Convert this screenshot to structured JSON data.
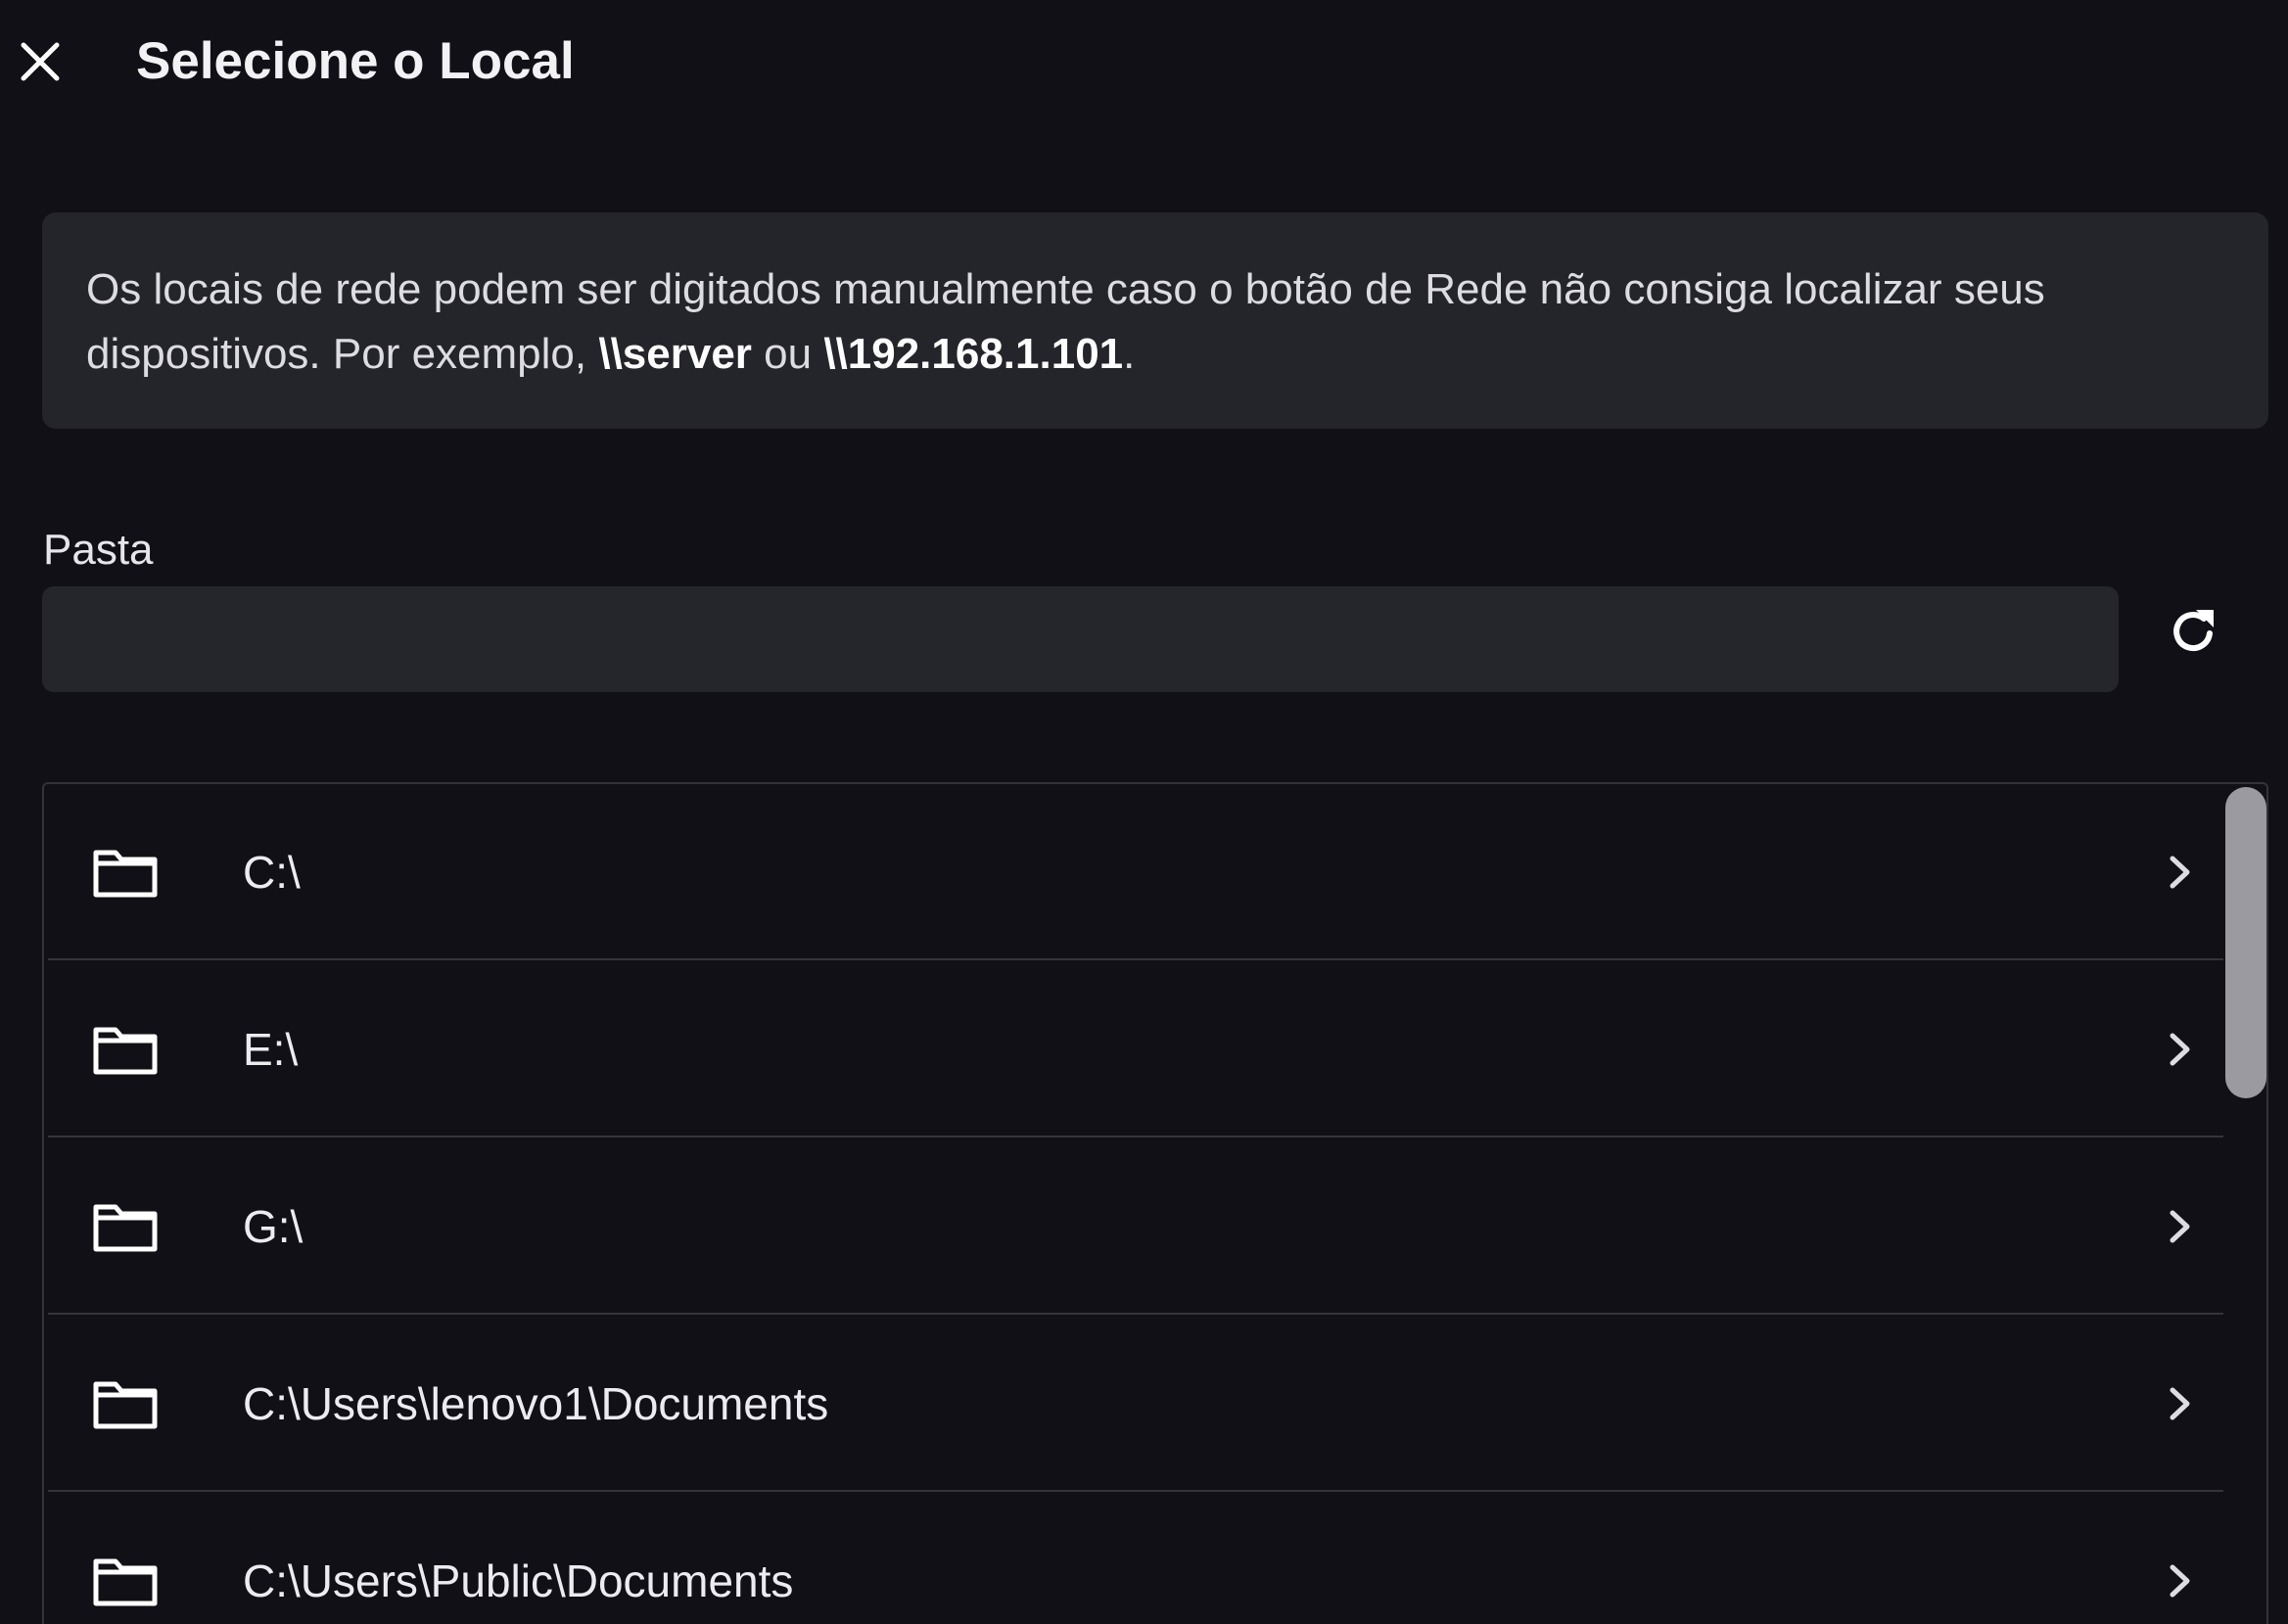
{
  "dialog": {
    "title": "Selecione o Local",
    "close_icon": "close-icon"
  },
  "info": {
    "text_part1": "Os locais de rede podem ser digitados manualmente caso o botão de Rede não consiga localizar seus dispositivos. Por exemplo, ",
    "example1": "\\\\server",
    "text_part2": " ou ",
    "example2": "\\\\192.168.1.101",
    "text_part3": "."
  },
  "folder_field": {
    "label": "Pasta",
    "value": "",
    "placeholder": "",
    "refresh_icon": "refresh-icon"
  },
  "locations": [
    {
      "label": "C:\\",
      "icon": "folder-icon",
      "action_icon": "chevron-right-icon"
    },
    {
      "label": "E:\\",
      "icon": "folder-icon",
      "action_icon": "chevron-right-icon"
    },
    {
      "label": "G:\\",
      "icon": "folder-icon",
      "action_icon": "chevron-right-icon"
    },
    {
      "label": "C:\\Users\\lenovo1\\Documents",
      "icon": "folder-icon",
      "action_icon": "chevron-right-icon"
    },
    {
      "label": "C:\\Users\\Public\\Documents",
      "icon": "folder-icon",
      "action_icon": "chevron-right-icon"
    }
  ],
  "colors": {
    "background": "#101016",
    "panel": "#24242b",
    "input": "#25252c",
    "divider": "#34343b",
    "text": "#e9e9ee",
    "scroll_thumb": "#9a9aa0"
  }
}
